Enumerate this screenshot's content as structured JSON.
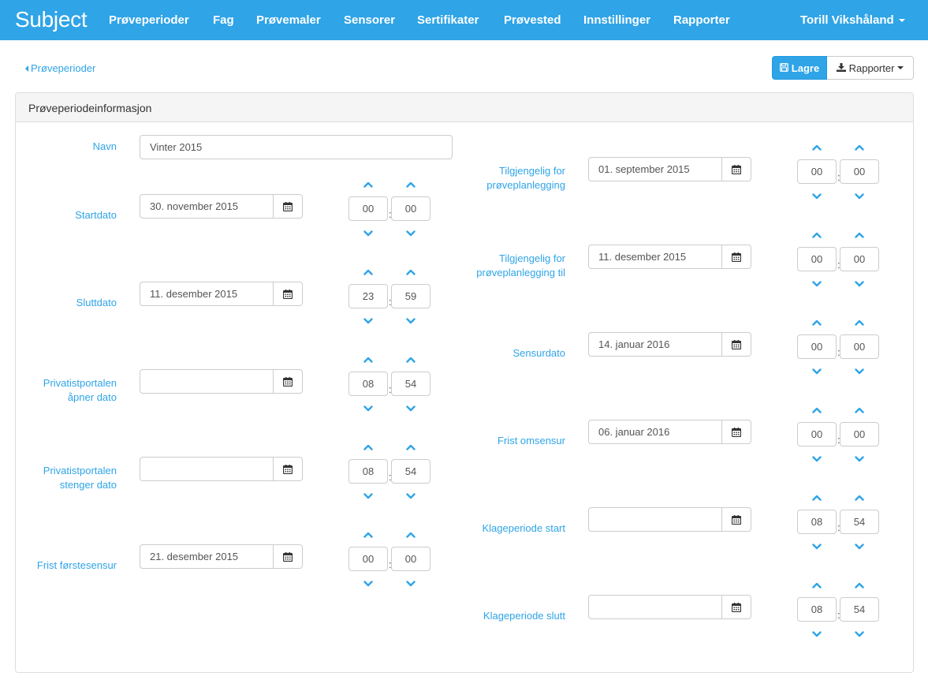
{
  "navbar": {
    "brand": "Subject",
    "items": [
      {
        "label": "Prøveperioder"
      },
      {
        "label": "Fag"
      },
      {
        "label": "Prøvemaler"
      },
      {
        "label": "Sensorer"
      },
      {
        "label": "Sertifikater"
      },
      {
        "label": "Prøvested"
      },
      {
        "label": "Innstillinger"
      },
      {
        "label": "Rapporter"
      }
    ],
    "user": "Torill Vikshåland",
    "color": "#2fa4e7"
  },
  "toolbar": {
    "back_label": "Prøveperioder",
    "save_label": "Lagre",
    "report_label": "Rapporter"
  },
  "panel": {
    "title": "Prøveperiodeinformasjon",
    "name_label": "Navn",
    "name_value": "Vinter 2015",
    "left_fields": [
      {
        "label": "Startdato",
        "date": "30. november 2015",
        "hour": "00",
        "minute": "00"
      },
      {
        "label": "Sluttdato",
        "date": "11. desember 2015",
        "hour": "23",
        "minute": "59"
      },
      {
        "label": "Privatistportalen åpner dato",
        "date": "",
        "hour": "08",
        "minute": "54"
      },
      {
        "label": "Privatistportalen stenger dato",
        "date": "",
        "hour": "08",
        "minute": "54"
      },
      {
        "label": "Frist førstesensur",
        "date": "21. desember 2015",
        "hour": "00",
        "minute": "00"
      }
    ],
    "right_fields": [
      {
        "label": "Tilgjengelig for prøveplanlegging",
        "date": "01. september 2015",
        "hour": "00",
        "minute": "00"
      },
      {
        "label": "Tilgjengelig for prøveplanlegging til",
        "date": "11. desember 2015",
        "hour": "00",
        "minute": "00"
      },
      {
        "label": "Sensurdato",
        "date": "14. januar 2016",
        "hour": "00",
        "minute": "00"
      },
      {
        "label": "Frist omsensur",
        "date": "06. januar 2016",
        "hour": "00",
        "minute": "00"
      },
      {
        "label": "Klageperiode start",
        "date": "",
        "hour": "08",
        "minute": "54"
      },
      {
        "label": "Klageperiode slutt",
        "date": "",
        "hour": "08",
        "minute": "54"
      }
    ]
  },
  "icons": {
    "back": "caret-left-icon",
    "save": "floppy-disk-icon",
    "report": "download-icon",
    "calendar": "calendar-icon",
    "spin_up": "chevron-up-icon",
    "spin_down": "chevron-down-icon"
  }
}
